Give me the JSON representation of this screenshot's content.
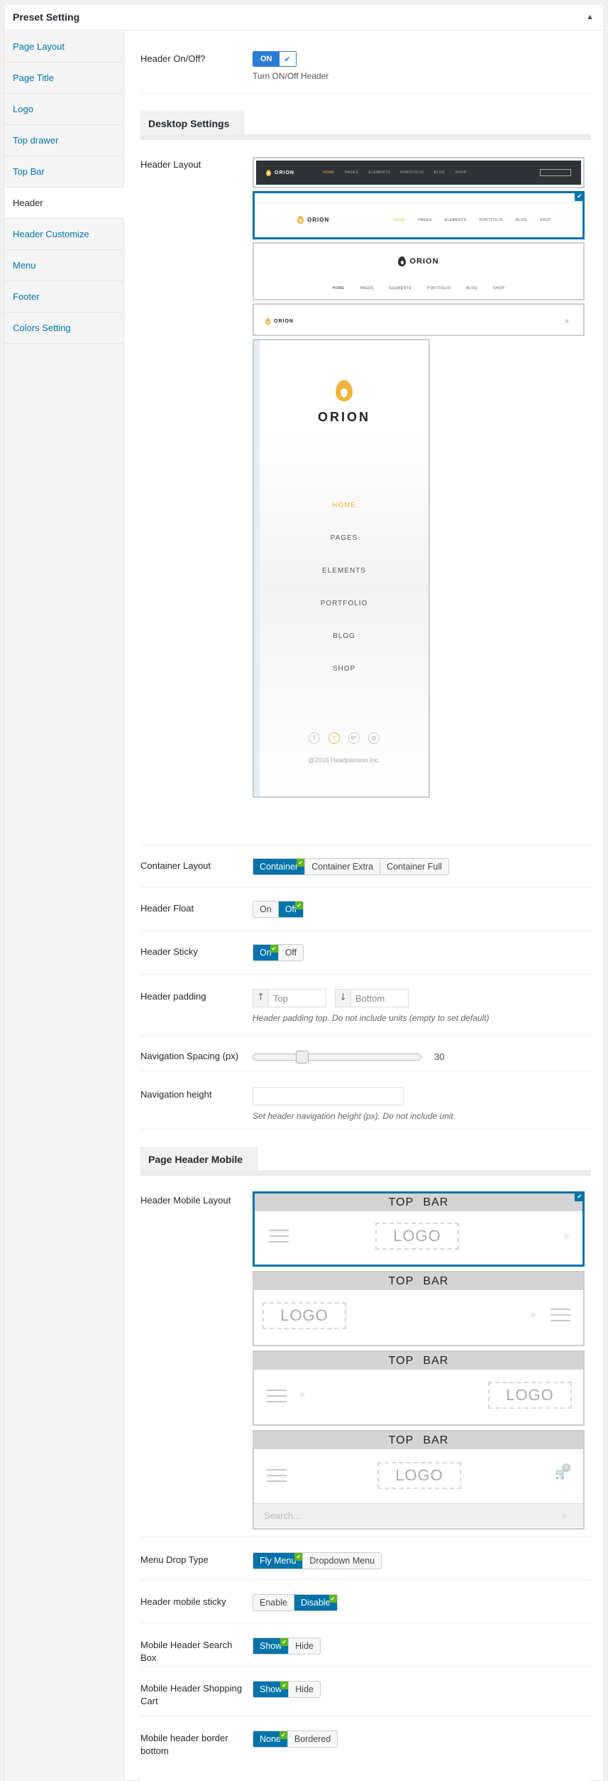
{
  "panel": {
    "title": "Preset Setting"
  },
  "sidebar": {
    "items": [
      {
        "label": "Page Layout"
      },
      {
        "label": "Page Title"
      },
      {
        "label": "Logo"
      },
      {
        "label": "Top drawer"
      },
      {
        "label": "Top Bar"
      },
      {
        "label": "Header"
      },
      {
        "label": "Header Customize"
      },
      {
        "label": "Menu"
      },
      {
        "label": "Footer"
      },
      {
        "label": "Colors Setting"
      }
    ],
    "active": "Header"
  },
  "header_onoff": {
    "label": "Header On/Off?",
    "state": "ON",
    "description": "Turn ON/Off Header"
  },
  "desktop_settings": {
    "title": "Desktop Settings",
    "header_layout": {
      "label": "Header Layout",
      "thumb1": {
        "logo": "ORION",
        "nav": [
          "HOME",
          "PAGES",
          "ELEMENTS",
          "PORTFOLIO",
          "BLOG",
          "SHOP"
        ]
      },
      "thumb2": {
        "logo": "ORION",
        "nav": [
          "HOME",
          "PAGES",
          "ELEMENTS",
          "PORTFOLIO",
          "BLOG",
          "SHOP"
        ]
      },
      "thumb3": {
        "logo": "ORION",
        "nav": [
          "HOME",
          "PAGES",
          "ELEMENTS",
          "PORTFOLIO",
          "BLOG",
          "SHOP"
        ]
      },
      "thumb4": {
        "logo": "ORION"
      },
      "vertical": {
        "logo": "ORION",
        "menu": [
          "HOME",
          "PAGES",
          "ELEMENTS",
          "PORTFOLIO",
          "BLOG",
          "SHOP"
        ],
        "copyright": "@2016 Headpassion Inc."
      }
    },
    "container_layout": {
      "label": "Container Layout",
      "options": [
        "Container",
        "Container Extra",
        "Container Full"
      ],
      "selected": "Container"
    },
    "header_float": {
      "label": "Header Float",
      "options": [
        "On",
        "Off"
      ],
      "selected": "Off"
    },
    "header_sticky": {
      "label": "Header Sticky",
      "options": [
        "On",
        "Off"
      ],
      "selected": "On"
    },
    "header_padding": {
      "label": "Header padding",
      "top_placeholder": "Top",
      "bottom_placeholder": "Bottom",
      "description": "Header padding top. Do not include units (empty to set default)"
    },
    "navigation_spacing": {
      "label": "Navigation Spacing (px)",
      "value": "30"
    },
    "navigation_height": {
      "label": "Navigation height",
      "value": "",
      "description": "Set header navigation height (px). Do not include unit."
    }
  },
  "mobile_settings": {
    "title": "Page Header Mobile",
    "header_mobile_layout": {
      "label": "Header Mobile Layout",
      "topbar": "TOP BAR",
      "logo": "LOGO",
      "search_placeholder": "Search...",
      "cart_count": "0"
    },
    "menu_drop_type": {
      "label": "Menu Drop Type",
      "options": [
        "Fly Menu",
        "Dropdown Menu"
      ],
      "selected": "Fly Menu"
    },
    "header_mobile_sticky": {
      "label": "Header mobile sticky",
      "options": [
        "Enable",
        "Disable"
      ],
      "selected": "Disable"
    },
    "mobile_search_box": {
      "label": "Mobile Header Search Box",
      "options": [
        "Show",
        "Hide"
      ],
      "selected": "Show"
    },
    "mobile_shopping_cart": {
      "label": "Mobile Header Shopping Cart",
      "options": [
        "Show",
        "Hide"
      ],
      "selected": "Show"
    },
    "mobile_border_bottom": {
      "label": "Mobile header border bottom",
      "options": [
        "None",
        "Bordered"
      ],
      "selected": "None"
    }
  },
  "colors": {
    "accent": "#0073aa",
    "check": "#5fb51c",
    "toggle": "#2b7cd3",
    "flame": "#f0b43c"
  }
}
